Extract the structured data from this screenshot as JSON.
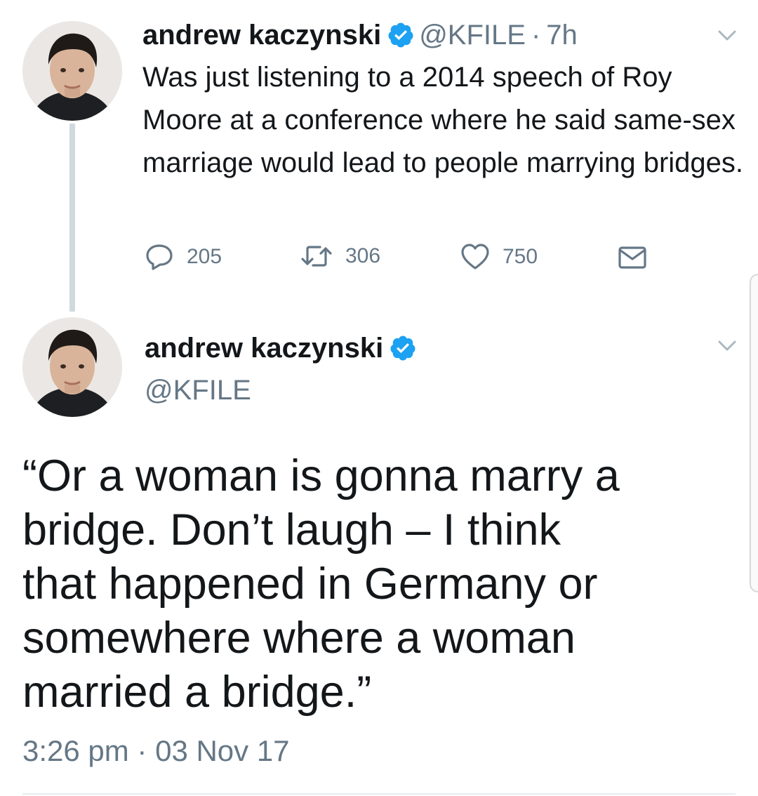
{
  "tweet1": {
    "name": "andrew kaczynski",
    "handle": "@KFILE",
    "dot": "·",
    "time": "7h",
    "text": "Was just listening to a 2014 speech of Roy Moore at a conference where he said same-sex marriage would lead to people marrying bridges.",
    "replies": "205",
    "retweets": "306",
    "likes": "750"
  },
  "tweet2": {
    "name": "andrew kaczynski",
    "handle": "@KFILE",
    "text": "“Or a woman is gonna marry a bridge. Don’t laugh – I think that happened in Germany or somewhere where a woman married a bridge.”",
    "timestamp": "3:26 pm · 03 Nov 17"
  },
  "colors": {
    "verified": "#1da1f2",
    "secondary_text": "#657786",
    "primary_text": "#14171a",
    "thread_line": "#cfd9de"
  },
  "icons": {
    "reply": "speech-bubble-icon",
    "retweet": "retweet-icon",
    "like": "heart-icon",
    "dm": "envelope-icon",
    "verified": "verified-badge-icon",
    "menu": "chevron-down-icon"
  }
}
